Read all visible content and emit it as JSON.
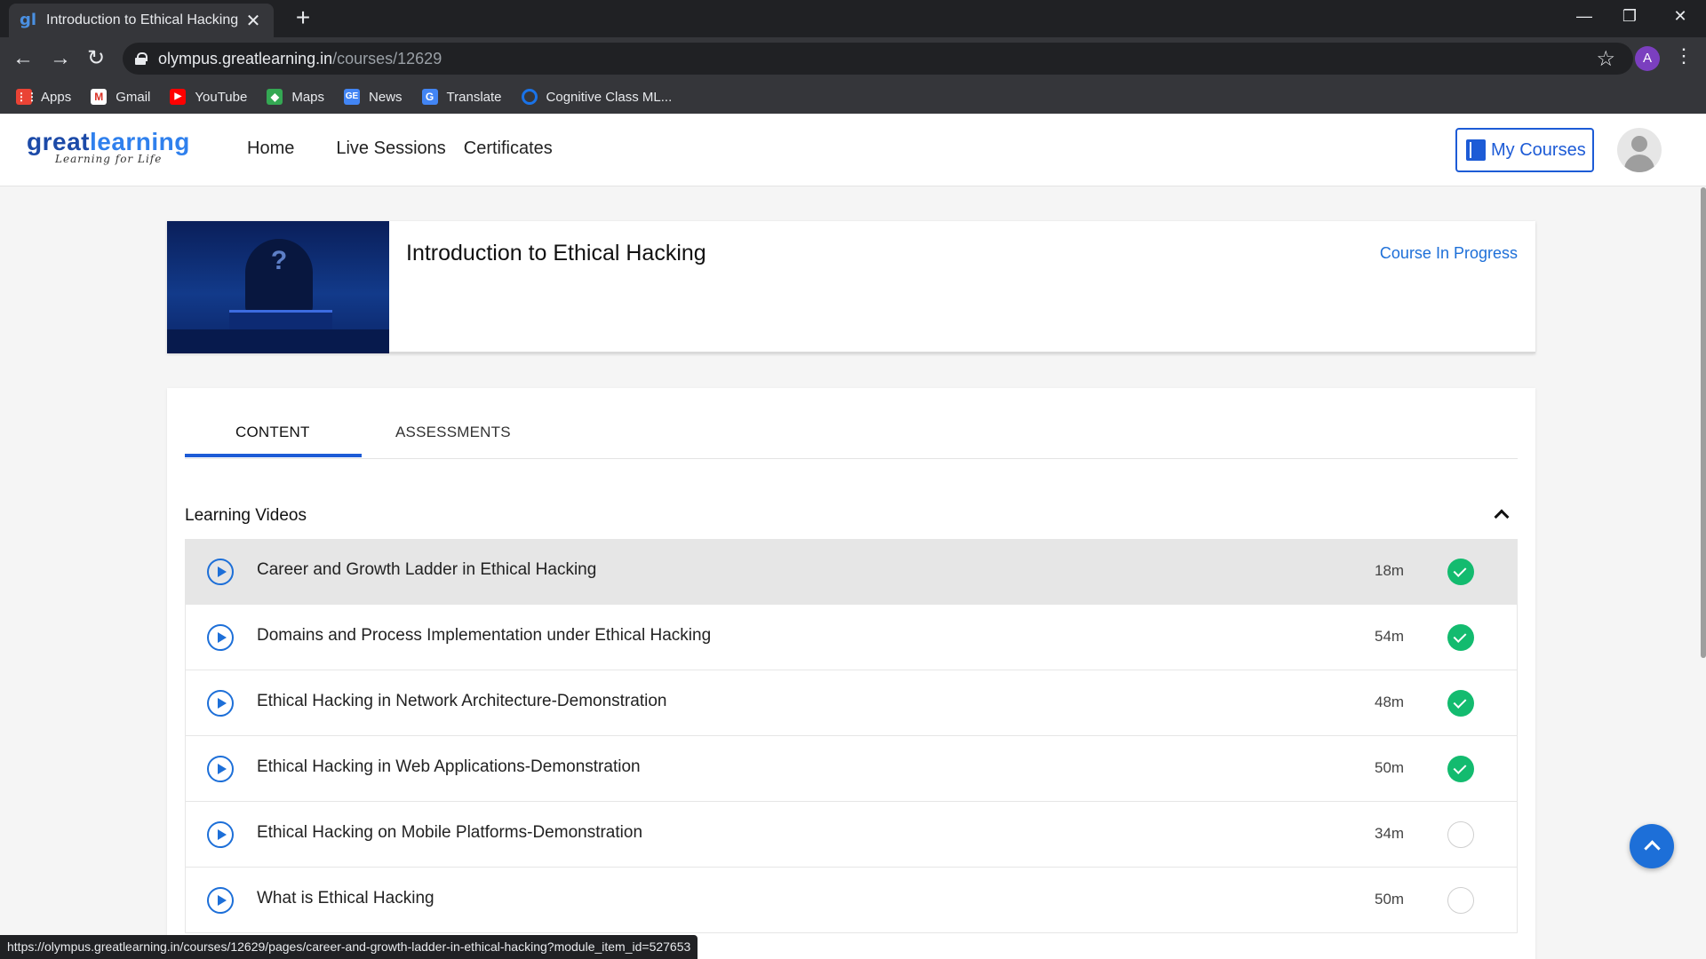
{
  "browser": {
    "tab_title": "Introduction to Ethical Hacking -",
    "favicon_text": "gl",
    "url_host": "olympus.greatlearning.in",
    "url_path": "/courses/12629",
    "profile_initial": "A",
    "bookmarks": [
      {
        "label": "Apps",
        "icon": "apps-grid-icon",
        "color": "#ea4335"
      },
      {
        "label": "Gmail",
        "icon": "gmail-icon",
        "color": "#d93025"
      },
      {
        "label": "YouTube",
        "icon": "youtube-icon",
        "color": "#ff0000"
      },
      {
        "label": "Maps",
        "icon": "maps-icon",
        "color": "#34a853"
      },
      {
        "label": "News",
        "icon": "news-icon",
        "color": "#4285f4"
      },
      {
        "label": "Translate",
        "icon": "translate-icon",
        "color": "#4285f4"
      },
      {
        "label": "Cognitive Class ML...",
        "icon": "cognitive-class-icon",
        "color": "#1a73e8"
      }
    ],
    "status_url": "https://olympus.greatlearning.in/courses/12629/pages/career-and-growth-ladder-in-ethical-hacking?module_item_id=527653"
  },
  "site": {
    "logo_great": "great",
    "logo_learning": "learning",
    "logo_tagline": "Learning for Life",
    "nav": [
      "Home",
      "Live Sessions",
      "Certificates"
    ],
    "my_courses_label": "My Courses"
  },
  "course": {
    "title": "Introduction to Ethical Hacking",
    "status": "Course In Progress",
    "thumb_symbol": "?"
  },
  "content": {
    "tabs": [
      "CONTENT",
      "ASSESSMENTS"
    ],
    "active_tab": "CONTENT",
    "section_title": "Learning Videos",
    "videos": [
      {
        "title": "Career and Growth Ladder in Ethical Hacking",
        "duration": "18m",
        "completed": true
      },
      {
        "title": "Domains and Process Implementation under Ethical Hacking",
        "duration": "54m",
        "completed": true
      },
      {
        "title": "Ethical Hacking in Network Architecture-Demonstration",
        "duration": "48m",
        "completed": true
      },
      {
        "title": "Ethical Hacking in Web Applications-Demonstration",
        "duration": "50m",
        "completed": true
      },
      {
        "title": "Ethical Hacking on Mobile Platforms-Demonstration",
        "duration": "34m",
        "completed": false
      },
      {
        "title": "What is Ethical Hacking",
        "duration": "50m",
        "completed": false
      }
    ]
  },
  "colors": {
    "accent": "#1d5bd6",
    "complete": "#13bb6f"
  }
}
